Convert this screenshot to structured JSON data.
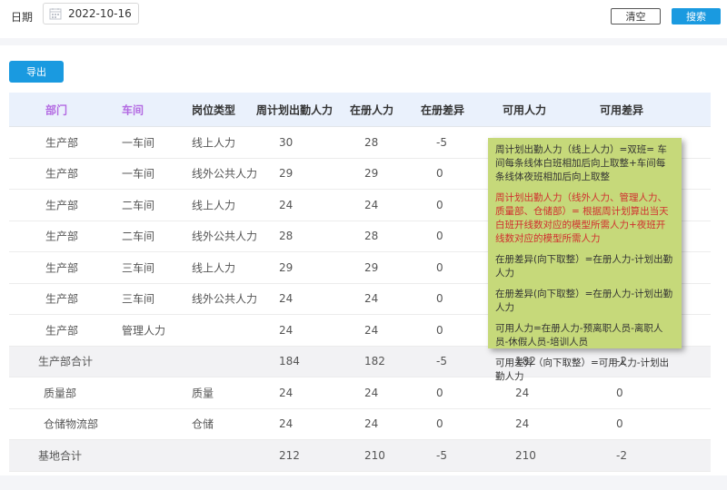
{
  "filter": {
    "date_label": "日期",
    "date_value": "2022-10-16",
    "clear_label": "清空",
    "search_label": "搜索"
  },
  "toolbar": {
    "export_label": "导出"
  },
  "table": {
    "headers": [
      "部门",
      "车间",
      "岗位类型",
      "周计划出勤人力",
      "在册人力",
      "在册差异",
      "可用人力",
      "可用差异"
    ],
    "rows": [
      {
        "dept": "生产部",
        "workshop": "一车间",
        "post": "线上人力",
        "plan": "30",
        "registered": "28",
        "reg_diff": "-5",
        "available": "",
        "avail_diff": ""
      },
      {
        "dept": "生产部",
        "workshop": "一车间",
        "post": "线外公共人力",
        "plan": "29",
        "registered": "29",
        "reg_diff": "0",
        "available": "",
        "avail_diff": ""
      },
      {
        "dept": "生产部",
        "workshop": "二车间",
        "post": "线上人力",
        "plan": "24",
        "registered": "24",
        "reg_diff": "0",
        "available": "",
        "avail_diff": ""
      },
      {
        "dept": "生产部",
        "workshop": "二车间",
        "post": "线外公共人力",
        "plan": "28",
        "registered": "28",
        "reg_diff": "0",
        "available": "",
        "avail_diff": ""
      },
      {
        "dept": "生产部",
        "workshop": "三车间",
        "post": "线上人力",
        "plan": "29",
        "registered": "29",
        "reg_diff": "0",
        "available": "",
        "avail_diff": ""
      },
      {
        "dept": "生产部",
        "workshop": "三车间",
        "post": "线外公共人力",
        "plan": "24",
        "registered": "24",
        "reg_diff": "0",
        "available": "",
        "avail_diff": ""
      },
      {
        "dept": "生产部",
        "workshop": "管理人力",
        "post": "",
        "plan": "24",
        "registered": "24",
        "reg_diff": "0",
        "available": "",
        "avail_diff": ""
      }
    ],
    "subtotal": {
      "label": "生产部合计",
      "plan": "184",
      "registered": "182",
      "reg_diff": "-5",
      "available": "182",
      "avail_diff": "-2"
    },
    "other_rows": [
      {
        "dept": "质量部",
        "post": "质量",
        "plan": "24",
        "registered": "24",
        "reg_diff": "0",
        "available": "24",
        "avail_diff": "0"
      },
      {
        "dept": "仓储物流部",
        "post": "仓储",
        "plan": "24",
        "registered": "24",
        "reg_diff": "0",
        "available": "24",
        "avail_diff": "0"
      }
    ],
    "total": {
      "label": "基地合计",
      "plan": "212",
      "registered": "210",
      "reg_diff": "-5",
      "available": "210",
      "avail_diff": "-2"
    }
  },
  "tooltip": {
    "notes": [
      "周计划出勤人力（线上人力）=双班= 车间每条线体白班相加后向上取整+车间每条线体夜班相加后向上取整",
      "周计划出勤人力（线外人力、管理人力、质量部、仓储部）= 根据周计划算出当天白班开线数对应的模型所需人力+夜班开线数对应的模型所需人力",
      "在册差异(向下取整）=在册人力-计划出勤人力",
      "在册差异(向下取整）=在册人力-计划出勤人力",
      "可用人力=在册人力-预离职人员-离职人员-休假人员-培训人员",
      "可用差异（向下取整）=可用人力-计划出勤人力"
    ]
  },
  "colors": {
    "primary": "#1a9ae0",
    "header_bg": "#eaf1fc",
    "accent_header": "#b36ae2",
    "tooltip_bg": "#c6d97a",
    "tooltip_red": "#d0302f"
  }
}
